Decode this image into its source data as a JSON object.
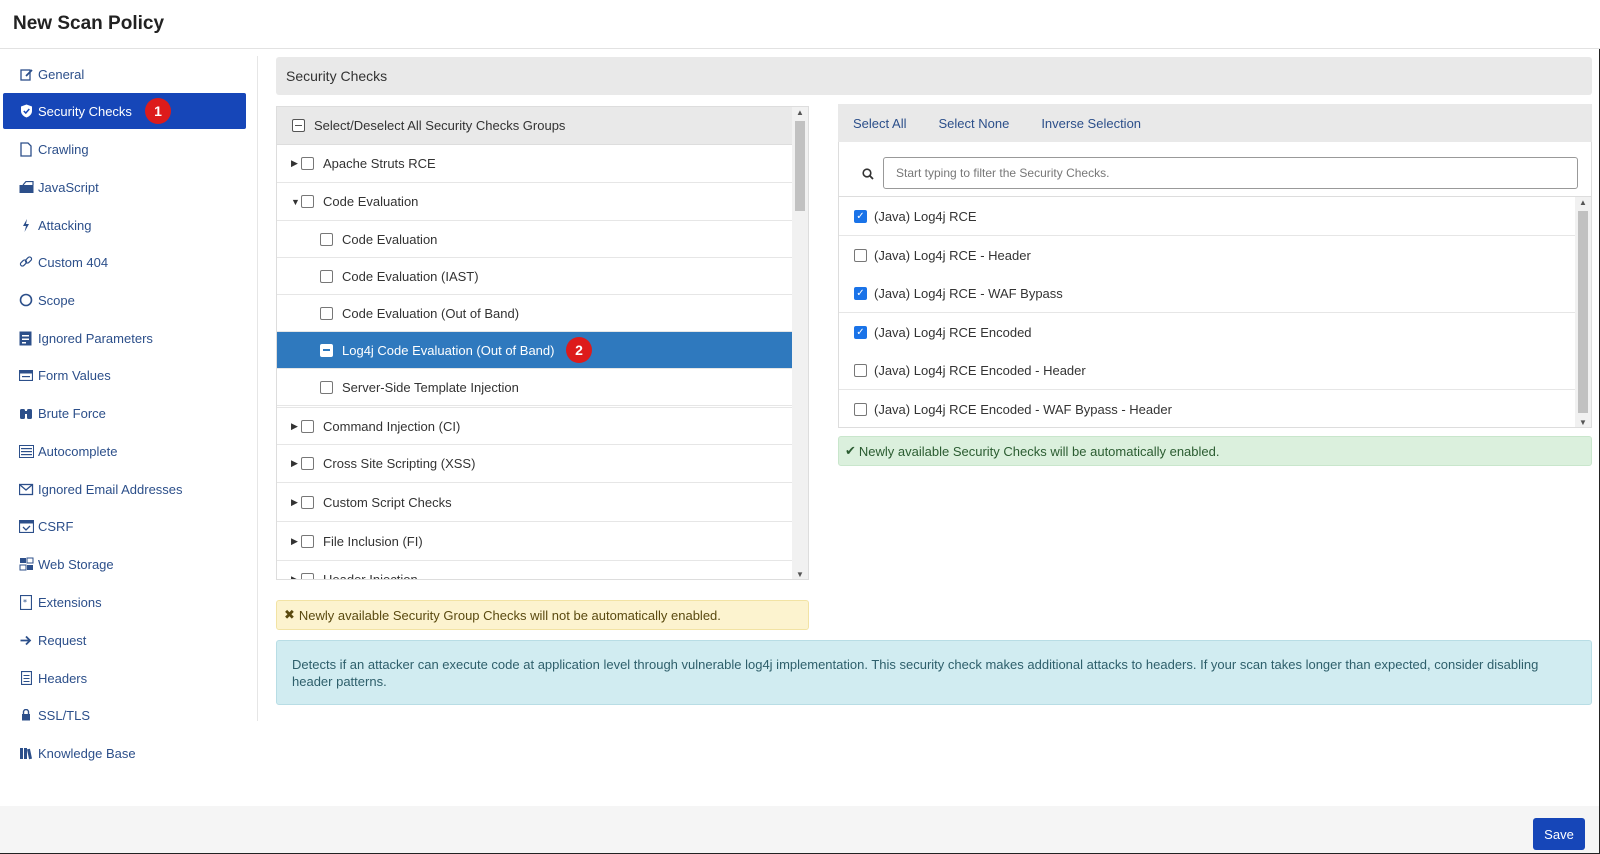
{
  "header": {
    "title": "New Scan Policy"
  },
  "sidebar": {
    "items": [
      {
        "label": "General",
        "icon": "edit-icon"
      },
      {
        "label": "Security Checks",
        "icon": "shield-icon",
        "active": true,
        "badge": "1"
      },
      {
        "label": "Crawling",
        "icon": "page-icon"
      },
      {
        "label": "JavaScript",
        "icon": "code-file-icon"
      },
      {
        "label": "Attacking",
        "icon": "bolt-icon"
      },
      {
        "label": "Custom 404",
        "icon": "link-icon"
      },
      {
        "label": "Scope",
        "icon": "circle-icon"
      },
      {
        "label": "Ignored Parameters",
        "icon": "filter-doc-icon"
      },
      {
        "label": "Form Values",
        "icon": "form-icon"
      },
      {
        "label": "Brute Force",
        "icon": "binoculars-icon"
      },
      {
        "label": "Autocomplete",
        "icon": "list-icon"
      },
      {
        "label": "Ignored Email Addresses",
        "icon": "email-icon"
      },
      {
        "label": "CSRF",
        "icon": "csrf-icon"
      },
      {
        "label": "Web Storage",
        "icon": "storage-icon"
      },
      {
        "label": "Extensions",
        "icon": "extension-icon"
      },
      {
        "label": "Request",
        "icon": "arrow-right-icon"
      },
      {
        "label": "Headers",
        "icon": "doc-icon"
      },
      {
        "label": "SSL/TLS",
        "icon": "lock-icon"
      },
      {
        "label": "Knowledge Base",
        "icon": "books-icon"
      }
    ]
  },
  "section": {
    "title": "Security Checks"
  },
  "tree": {
    "header_label": "Select/Deselect All Security Checks Groups",
    "groups": [
      {
        "label": "Apache Struts RCE",
        "expanded": false
      },
      {
        "label": "Code Evaluation",
        "expanded": true
      },
      {
        "label": "Code Evaluation",
        "child": true
      },
      {
        "label": "Code Evaluation (IAST)",
        "child": true
      },
      {
        "label": "Code Evaluation (Out of Band)",
        "child": true
      },
      {
        "label": "Log4j Code Evaluation (Out of Band)",
        "child": true,
        "selected": true,
        "badge": "2"
      },
      {
        "label": "Server-Side Template Injection",
        "child": true
      },
      {
        "label": "Command Injection (CI)",
        "expanded": false
      },
      {
        "label": "Cross Site Scripting (XSS)",
        "expanded": false
      },
      {
        "label": "Custom Script Checks",
        "expanded": false
      },
      {
        "label": "File Inclusion (FI)",
        "expanded": false
      },
      {
        "label": "Header Injection",
        "expanded": false
      }
    ],
    "warning": "Newly available Security Group Checks will not be automatically enabled."
  },
  "checks": {
    "actions": [
      "Select All",
      "Select None",
      "Inverse Selection"
    ],
    "filter_placeholder": "Start typing to filter the Security Checks.",
    "items": [
      {
        "label": "(Java) Log4j RCE",
        "checked": true
      },
      {
        "label": "(Java) Log4j RCE - Header",
        "checked": false
      },
      {
        "label": "(Java) Log4j RCE - WAF Bypass",
        "checked": true
      },
      {
        "label": "(Java) Log4j RCE Encoded",
        "checked": true
      },
      {
        "label": "(Java) Log4j RCE Encoded - Header",
        "checked": false
      },
      {
        "label": "(Java) Log4j RCE Encoded - WAF Bypass - Header",
        "checked": false
      }
    ],
    "info": "Newly available Security Checks will be automatically enabled."
  },
  "description": "Detects if an attacker can execute code at application level through vulnerable log4j implementation. This security check makes additional attacks to headers. If your scan takes longer than expected, consider disabling header patterns.",
  "footer": {
    "save_label": "Save"
  },
  "colors": {
    "primary": "#1646b8",
    "selected_row": "#2f79be",
    "badge": "#dd1b1b",
    "warning_bg": "#fcf3cf",
    "success_bg": "#dbf0dd",
    "info_bg": "#d1ecf1"
  }
}
